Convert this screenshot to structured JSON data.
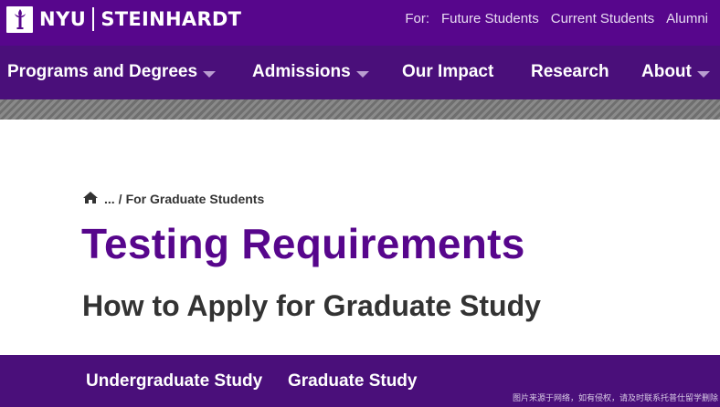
{
  "header": {
    "logo_university": "NYU",
    "logo_school": "STEINHARDT",
    "audience_label": "For:",
    "audience_links": [
      "Future Students",
      "Current Students",
      "Alumni"
    ]
  },
  "main_nav": {
    "items": [
      {
        "label": "Programs and Degrees",
        "has_dropdown": true
      },
      {
        "label": "Admissions",
        "has_dropdown": true
      },
      {
        "label": "Our Impact",
        "has_dropdown": false
      },
      {
        "label": "Research",
        "has_dropdown": false
      },
      {
        "label": "About",
        "has_dropdown": true
      }
    ]
  },
  "breadcrumb": {
    "home_icon": "home-icon",
    "ellipsis": "...",
    "separator": "/",
    "current": "For Graduate Students"
  },
  "page": {
    "title": "Testing Requirements",
    "subtitle": "How to Apply for Graduate Study"
  },
  "sub_nav": {
    "items": [
      "Undergraduate Study",
      "Graduate Study"
    ]
  },
  "watermark": "图片来源于网络，如有侵权，请及时联系托普仕留学删除",
  "colors": {
    "brand_purple": "#57068c",
    "nav_purple": "#4a0f7a",
    "text_dark": "#333333"
  }
}
